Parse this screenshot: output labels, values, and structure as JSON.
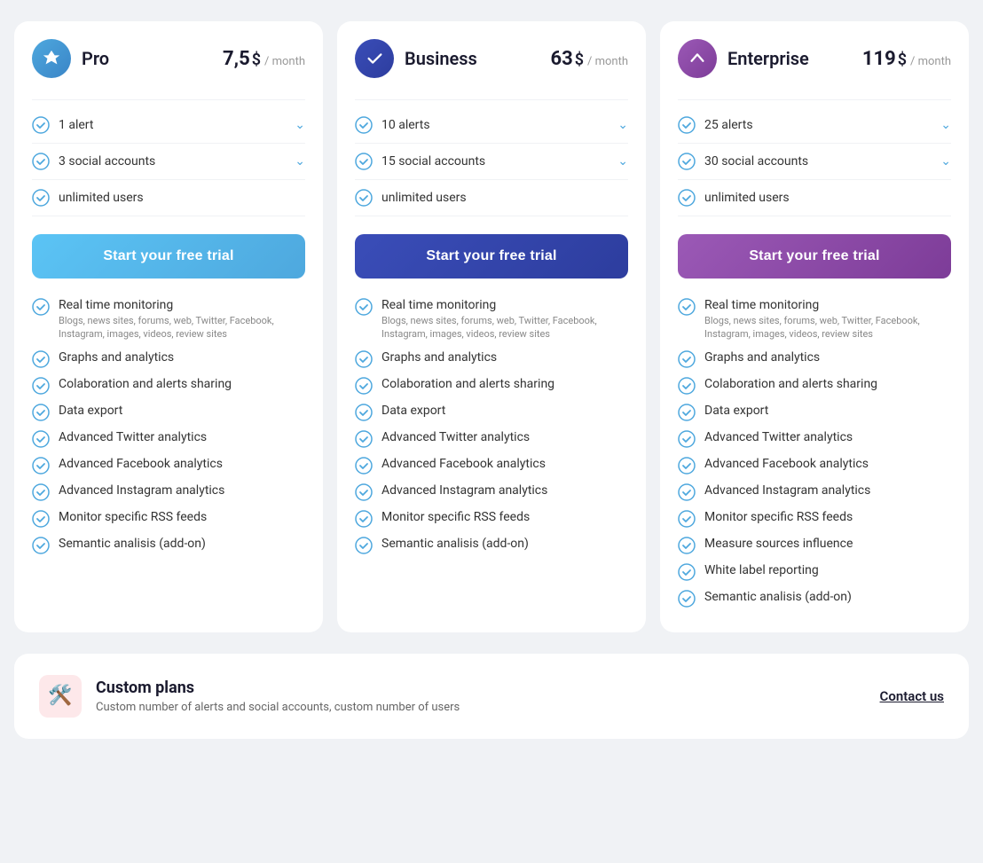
{
  "plans": [
    {
      "id": "pro",
      "name": "Pro",
      "price": "7,5",
      "currency": "$",
      "period": "month",
      "icon_class": "icon-pro",
      "btn_class": "btn-pro",
      "btn_label": "Start your free trial",
      "header_features": [
        {
          "label": "1 alert",
          "has_chevron": true
        },
        {
          "label": "3 social accounts",
          "has_chevron": true
        },
        {
          "label": "unlimited users",
          "has_chevron": false
        }
      ],
      "features": [
        {
          "label": "Real time monitoring",
          "sub": "Blogs, news sites, forums, web, Twitter, Facebook, Instagram, images, videos, review sites"
        },
        {
          "label": "Graphs and analytics",
          "sub": ""
        },
        {
          "label": "Colaboration and alerts sharing",
          "sub": ""
        },
        {
          "label": "Data export",
          "sub": ""
        },
        {
          "label": "Advanced Twitter analytics",
          "sub": ""
        },
        {
          "label": "Advanced Facebook analytics",
          "sub": ""
        },
        {
          "label": "Advanced Instagram analytics",
          "sub": ""
        },
        {
          "label": "Monitor specific RSS feeds",
          "sub": ""
        },
        {
          "label": "Semantic analisis (add-on)",
          "sub": ""
        }
      ]
    },
    {
      "id": "business",
      "name": "Business",
      "price": "63",
      "currency": "$",
      "period": "month",
      "icon_class": "icon-business",
      "btn_class": "btn-business",
      "btn_label": "Start your free trial",
      "header_features": [
        {
          "label": "10 alerts",
          "has_chevron": true
        },
        {
          "label": "15 social accounts",
          "has_chevron": true
        },
        {
          "label": "unlimited users",
          "has_chevron": false
        }
      ],
      "features": [
        {
          "label": "Real time monitoring",
          "sub": "Blogs, news sites, forums, web, Twitter, Facebook, Instagram, images, videos, review sites"
        },
        {
          "label": "Graphs and analytics",
          "sub": ""
        },
        {
          "label": "Colaboration and alerts sharing",
          "sub": ""
        },
        {
          "label": "Data export",
          "sub": ""
        },
        {
          "label": "Advanced Twitter analytics",
          "sub": ""
        },
        {
          "label": "Advanced Facebook analytics",
          "sub": ""
        },
        {
          "label": "Advanced Instagram analytics",
          "sub": ""
        },
        {
          "label": "Monitor specific RSS feeds",
          "sub": ""
        },
        {
          "label": "Semantic analisis (add-on)",
          "sub": ""
        }
      ]
    },
    {
      "id": "enterprise",
      "name": "Enterprise",
      "price": "119",
      "currency": "$",
      "period": "month",
      "icon_class": "icon-enterprise",
      "btn_class": "btn-enterprise",
      "btn_label": "Start your free trial",
      "header_features": [
        {
          "label": "25 alerts",
          "has_chevron": true
        },
        {
          "label": "30 social accounts",
          "has_chevron": true
        },
        {
          "label": "unlimited users",
          "has_chevron": false
        }
      ],
      "features": [
        {
          "label": "Real time monitoring",
          "sub": "Blogs, news sites, forums, web, Twitter, Facebook, Instagram, images, videos, review sites"
        },
        {
          "label": "Graphs and analytics",
          "sub": ""
        },
        {
          "label": "Colaboration and alerts sharing",
          "sub": ""
        },
        {
          "label": "Data export",
          "sub": ""
        },
        {
          "label": "Advanced Twitter analytics",
          "sub": ""
        },
        {
          "label": "Advanced Facebook analytics",
          "sub": ""
        },
        {
          "label": "Advanced Instagram analytics",
          "sub": ""
        },
        {
          "label": "Monitor specific RSS feeds",
          "sub": ""
        },
        {
          "label": "Measure sources influence",
          "sub": ""
        },
        {
          "label": "White label reporting",
          "sub": ""
        },
        {
          "label": "Semantic analisis (add-on)",
          "sub": ""
        }
      ]
    }
  ],
  "custom": {
    "title": "Custom plans",
    "description": "Custom number of alerts and social accounts, custom number of users",
    "contact_label": "Contact us"
  },
  "icons": {
    "check_color": "#4ea8de",
    "chevron_color": "#4ea8de"
  }
}
